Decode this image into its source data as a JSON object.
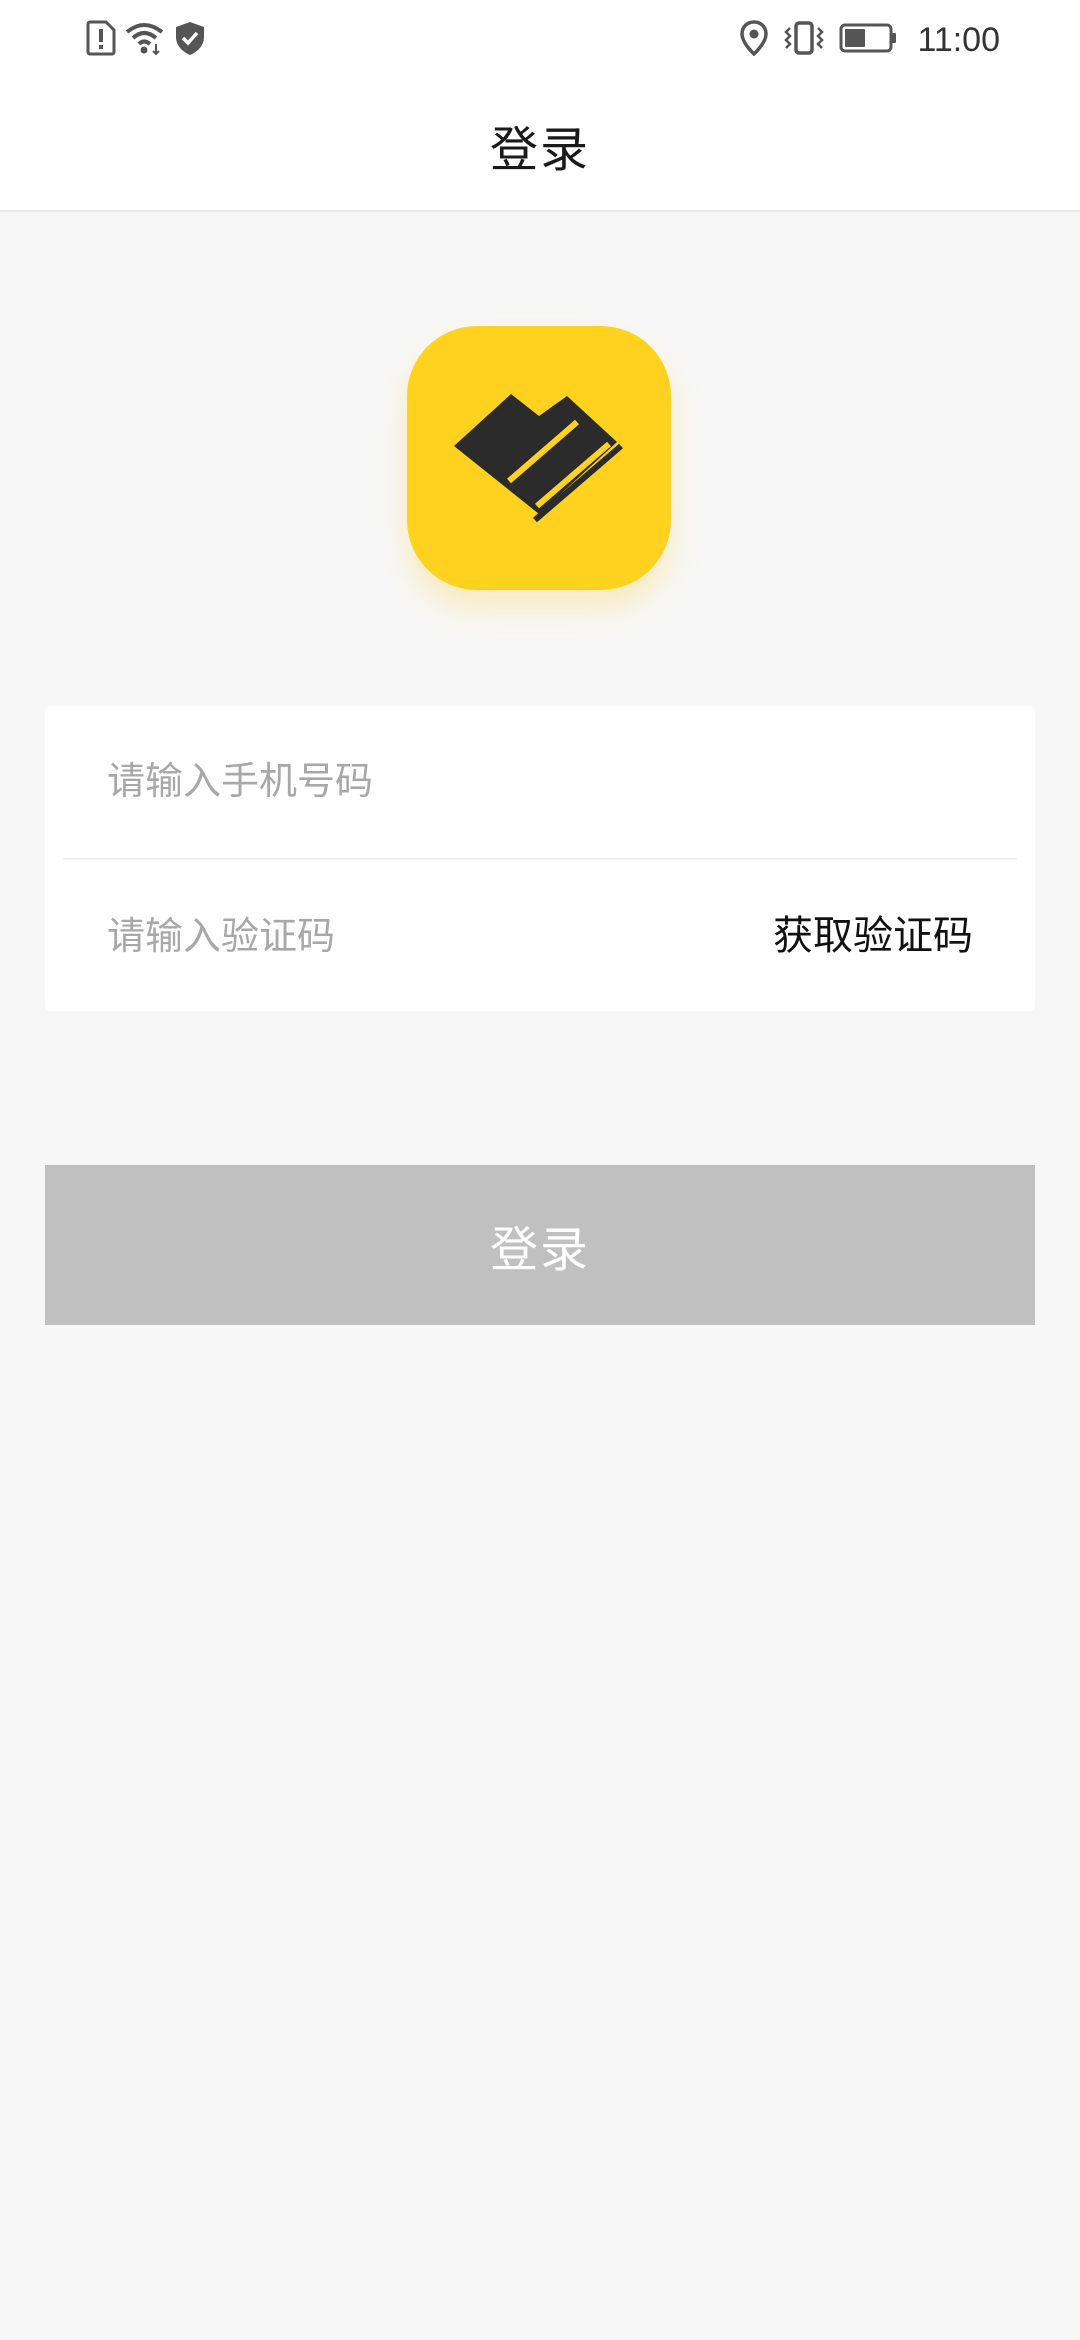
{
  "status_bar": {
    "time": "11:00",
    "left_icons": [
      "sim-alert-icon",
      "wifi-icon",
      "shield-check-icon"
    ],
    "right_icons": [
      "location-icon",
      "vibrate-icon",
      "battery-icon"
    ]
  },
  "header": {
    "title": "登录"
  },
  "app_logo": {
    "icon": "app-logo-icon",
    "color": "#ffd21f"
  },
  "form": {
    "phone_placeholder": "请输入手机号码",
    "phone_value": "",
    "code_placeholder": "请输入验证码",
    "code_value": "",
    "get_code_label": "获取验证码"
  },
  "login_button": {
    "label": "登录",
    "color": "#c0c0c0"
  }
}
